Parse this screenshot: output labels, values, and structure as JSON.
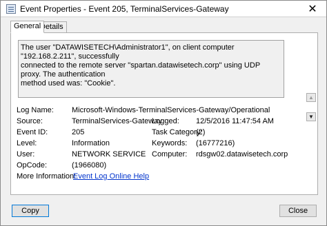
{
  "window": {
    "title": "Event Properties - Event 205, TerminalServices-Gateway",
    "close_glyph": "✕"
  },
  "tabs": [
    {
      "label": "General"
    },
    {
      "label": "Details"
    }
  ],
  "description": {
    "lines": [
      "The user \"DATAWISETECH\\Administrator1\", on client computer \"192.168.2.211\", successfully",
      "connected to the remote server \"spartan.datawisetech.corp\" using UDP proxy. The authentication",
      "method used was: \"Cookie\"."
    ]
  },
  "fields": {
    "log_name": {
      "label": "Log Name:",
      "value": "Microsoft-Windows-TerminalServices-Gateway/Operational"
    },
    "source": {
      "label": "Source:",
      "value": "TerminalServices-Gateway"
    },
    "logged": {
      "label": "Logged:",
      "value": "12/5/2016 11:47:54 AM"
    },
    "event_id": {
      "label": "Event ID:",
      "value": "205"
    },
    "task_category": {
      "label": "Task Category:",
      "value": "(2)"
    },
    "level": {
      "label": "Level:",
      "value": "Information"
    },
    "keywords": {
      "label": "Keywords:",
      "value": "(16777216)"
    },
    "user": {
      "label": "User:",
      "value": "NETWORK SERVICE"
    },
    "computer": {
      "label": "Computer:",
      "value": "rdsgw02.datawisetech.corp"
    },
    "opcode": {
      "label": "OpCode:",
      "value": "(1966080)"
    },
    "more_info": {
      "label": "More Information:",
      "link": "Event Log Online Help"
    }
  },
  "nav": {
    "up_glyph": "▲",
    "down_glyph": "▼"
  },
  "buttons": {
    "copy": "Copy",
    "close": "Close"
  }
}
